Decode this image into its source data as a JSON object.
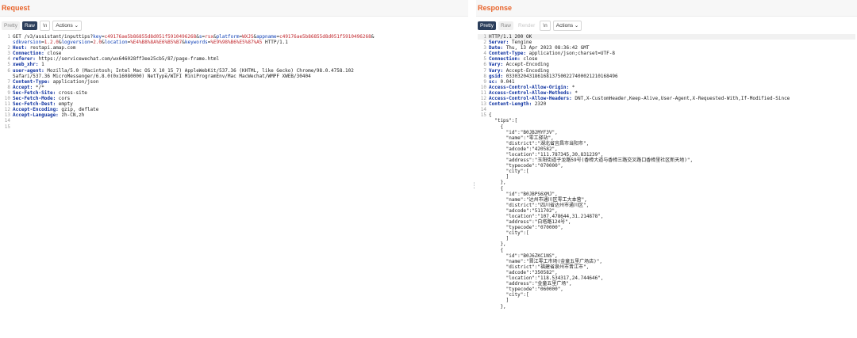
{
  "request": {
    "title": "Request",
    "tabs": [
      "Pretty",
      "Raw",
      "\\n",
      "Actions"
    ],
    "lines": [
      {
        "n": "1",
        "parts": [
          [
            "GET /v3/assistant/inputtips?",
            ""
          ],
          [
            "key",
            "pk"
          ],
          [
            "=",
            ""
          ],
          [
            "c49176ae5b86855d8d051f5910496268",
            "pv"
          ],
          [
            "&",
            ""
          ],
          [
            "s",
            "pk"
          ],
          [
            "=",
            ""
          ],
          [
            "rsx",
            "pv"
          ],
          [
            "&",
            ""
          ],
          [
            "platform",
            "pk"
          ],
          [
            "=",
            ""
          ],
          [
            "WXJS",
            "pv"
          ],
          [
            "&",
            ""
          ],
          [
            "appname",
            "pk"
          ],
          [
            "=",
            ""
          ],
          [
            "c49176ae5b86855d8d051f5910496268",
            "pv"
          ],
          [
            "&",
            ""
          ]
        ]
      },
      {
        "n": "",
        "parts": [
          [
            "sdkversion",
            "pk"
          ],
          [
            "=",
            ""
          ],
          [
            "1.2.0",
            "pv"
          ],
          [
            "&",
            ""
          ],
          [
            "logversion",
            "pk"
          ],
          [
            "=",
            ""
          ],
          [
            "2.0",
            "pv"
          ],
          [
            "&",
            ""
          ],
          [
            "location",
            "pk"
          ],
          [
            "=",
            ""
          ],
          [
            "%E4%B8%8A%E6%B5%B7",
            "pv"
          ],
          [
            "&",
            ""
          ],
          [
            "keywords",
            "pk"
          ],
          [
            "=",
            ""
          ],
          [
            "%E9%98%B6%E5%87%A5",
            "pv"
          ],
          [
            " HTTP/1.1",
            ""
          ]
        ]
      },
      {
        "n": "2",
        "parts": [
          [
            "Host: ",
            "k"
          ],
          [
            "restapi.amap.com",
            ""
          ]
        ]
      },
      {
        "n": "3",
        "parts": [
          [
            "Connection: ",
            "k"
          ],
          [
            "close",
            ""
          ]
        ]
      },
      {
        "n": "4",
        "parts": [
          [
            "referer: ",
            "k"
          ],
          [
            "https://servicewechat.com/wx646028ff3ee25cb5/87/page-frame.html",
            ""
          ]
        ]
      },
      {
        "n": "5",
        "parts": [
          [
            "xweb_xhr: ",
            "k"
          ],
          [
            "1",
            ""
          ]
        ]
      },
      {
        "n": "6",
        "parts": [
          [
            "user-agent: ",
            "k"
          ],
          [
            "Mozilla/5.0 (Macintosh; Intel Mac OS X 10_15_7) AppleWebKit/537.36 (KHTML, like Gecko) Chrome/98.0.4758.102",
            ""
          ]
        ]
      },
      {
        "n": "",
        "parts": [
          [
            "Safari/537.36 MicroMessenger/6.8.0(0x16080000) NetType/WIFI MiniProgramEnv/Mac MacWechat/WMPF XWEB/30404",
            ""
          ]
        ]
      },
      {
        "n": "7",
        "parts": [
          [
            "Content-Type: ",
            "k"
          ],
          [
            "application/json",
            ""
          ]
        ]
      },
      {
        "n": "8",
        "parts": [
          [
            "Accept: ",
            "k"
          ],
          [
            "*/*",
            ""
          ]
        ]
      },
      {
        "n": "9",
        "parts": [
          [
            "Sec-Fetch-Site: ",
            "k"
          ],
          [
            "cross-site",
            ""
          ]
        ]
      },
      {
        "n": "10",
        "parts": [
          [
            "Sec-Fetch-Mode: ",
            "k"
          ],
          [
            "cors",
            ""
          ]
        ]
      },
      {
        "n": "11",
        "parts": [
          [
            "Sec-Fetch-Dest: ",
            "k"
          ],
          [
            "empty",
            ""
          ]
        ]
      },
      {
        "n": "12",
        "parts": [
          [
            "Accept-Encoding: ",
            "k"
          ],
          [
            "gzip, deflate",
            ""
          ]
        ]
      },
      {
        "n": "13",
        "parts": [
          [
            "Accept-Language: ",
            "k"
          ],
          [
            "zh-CN,zh",
            ""
          ]
        ]
      },
      {
        "n": "14",
        "parts": []
      },
      {
        "n": "15",
        "parts": []
      }
    ]
  },
  "response": {
    "title": "Response",
    "tabs": [
      "Pretty",
      "Raw",
      "Render",
      "\\n",
      "Actions"
    ],
    "lines": [
      {
        "n": "1",
        "parts": [
          [
            "HTTP/1.1 200 OK",
            ""
          ]
        ]
      },
      {
        "n": "2",
        "parts": [
          [
            "Server: ",
            "k"
          ],
          [
            "Tengine",
            ""
          ]
        ]
      },
      {
        "n": "3",
        "parts": [
          [
            "Date: ",
            "k"
          ],
          [
            "Thu, 13 Apr 2023 08:36:42 GMT",
            ""
          ]
        ]
      },
      {
        "n": "4",
        "parts": [
          [
            "Content-Type: ",
            "k"
          ],
          [
            "application/json;charset=UTF-8",
            ""
          ]
        ]
      },
      {
        "n": "5",
        "parts": [
          [
            "Connection: ",
            "k"
          ],
          [
            "close",
            ""
          ]
        ]
      },
      {
        "n": "6",
        "parts": [
          [
            "Vary: ",
            "k"
          ],
          [
            "Accept-Encoding",
            ""
          ]
        ]
      },
      {
        "n": "7",
        "parts": [
          [
            "Vary: ",
            "k"
          ],
          [
            "Accept-Encoding",
            ""
          ]
        ]
      },
      {
        "n": "8",
        "parts": [
          [
            "gsid: ",
            "k"
          ],
          [
            "033032043186168137500227400021210168496",
            ""
          ]
        ]
      },
      {
        "n": "9",
        "parts": [
          [
            "sc: ",
            "k"
          ],
          [
            "0.041",
            ""
          ]
        ]
      },
      {
        "n": "10",
        "parts": [
          [
            "Access-Control-Allow-Origin: ",
            "k"
          ],
          [
            "*",
            ""
          ]
        ]
      },
      {
        "n": "11",
        "parts": [
          [
            "Access-Control-Allow-Methods: ",
            "k"
          ],
          [
            "*",
            ""
          ]
        ]
      },
      {
        "n": "12",
        "parts": [
          [
            "Access-Control-Allow-Headers: ",
            "k"
          ],
          [
            "DNT,X-CustomHeader,Keep-Alive,User-Agent,X-Requested-With,If-Modified-Since",
            ""
          ]
        ]
      },
      {
        "n": "13",
        "parts": [
          [
            "Content-Length: ",
            "k"
          ],
          [
            "2320",
            ""
          ]
        ]
      },
      {
        "n": "14",
        "parts": []
      },
      {
        "n": "15",
        "parts": [
          [
            "{",
            ""
          ]
        ]
      },
      {
        "n": "",
        "parts": [
          [
            "  \"tips\":[",
            ""
          ]
        ]
      },
      {
        "n": "",
        "parts": [
          [
            "    {",
            ""
          ]
        ]
      },
      {
        "n": "",
        "parts": [
          [
            "      \"id\":\"B0JB2MYF3V\",",
            ""
          ]
        ]
      },
      {
        "n": "",
        "parts": [
          [
            "      \"name\":\"零工驿站\",",
            ""
          ]
        ]
      },
      {
        "n": "",
        "parts": [
          [
            "      \"district\":\"湖北省宜昌市当阳市\",",
            ""
          ]
        ]
      },
      {
        "n": "",
        "parts": [
          [
            "      \"adcode\":\"420582\",",
            ""
          ]
        ]
      },
      {
        "n": "",
        "parts": [
          [
            "      \"location\":\"111.787345,30.831239\",",
            ""
          ]
        ]
      },
      {
        "n": "",
        "parts": [
          [
            "      \"address\":\"玉阳街道子龙路59号(香樟大道与香樟三路交叉路口香樟里社区新天地)\",",
            ""
          ]
        ]
      },
      {
        "n": "",
        "parts": [
          [
            "      \"typecode\":\"070000\",",
            ""
          ]
        ]
      },
      {
        "n": "",
        "parts": [
          [
            "      \"city\":[",
            ""
          ]
        ]
      },
      {
        "n": "",
        "parts": [
          [
            "      ]",
            ""
          ]
        ]
      },
      {
        "n": "",
        "parts": [
          [
            "    },",
            ""
          ]
        ]
      },
      {
        "n": "",
        "parts": [
          [
            "    {",
            ""
          ]
        ]
      },
      {
        "n": "",
        "parts": [
          [
            "      \"id\":\"B0JBPS6XMJ\",",
            ""
          ]
        ]
      },
      {
        "n": "",
        "parts": [
          [
            "      \"name\":\"达州市通川区零工大本营\",",
            ""
          ]
        ]
      },
      {
        "n": "",
        "parts": [
          [
            "      \"district\":\"四川省达州市通川区\",",
            ""
          ]
        ]
      },
      {
        "n": "",
        "parts": [
          [
            "      \"adcode\":\"511702\",",
            ""
          ]
        ]
      },
      {
        "n": "",
        "parts": [
          [
            "      \"location\":\"107.478644,31.214878\",",
            ""
          ]
        ]
      },
      {
        "n": "",
        "parts": [
          [
            "      \"address\":\"白塔路124号\",",
            ""
          ]
        ]
      },
      {
        "n": "",
        "parts": [
          [
            "      \"typecode\":\"070000\",",
            ""
          ]
        ]
      },
      {
        "n": "",
        "parts": [
          [
            "      \"city\":[",
            ""
          ]
        ]
      },
      {
        "n": "",
        "parts": [
          [
            "      ]",
            ""
          ]
        ]
      },
      {
        "n": "",
        "parts": [
          [
            "    },",
            ""
          ]
        ]
      },
      {
        "n": "",
        "parts": [
          [
            "    {",
            ""
          ]
        ]
      },
      {
        "n": "",
        "parts": [
          [
            "      \"id\":\"B0J6ZKC1NS\",",
            ""
          ]
        ]
      },
      {
        "n": "",
        "parts": [
          [
            "      \"name\":\"晋江零工市场(金童五里广场店)\",",
            ""
          ]
        ]
      },
      {
        "n": "",
        "parts": [
          [
            "      \"district\":\"福建省泉州市晋江市\",",
            ""
          ]
        ]
      },
      {
        "n": "",
        "parts": [
          [
            "      \"adcode\":\"350582\",",
            ""
          ]
        ]
      },
      {
        "n": "",
        "parts": [
          [
            "      \"location\":\"118.534317,24.744646\",",
            ""
          ]
        ]
      },
      {
        "n": "",
        "parts": [
          [
            "      \"address\":\"金童五里广场\",",
            ""
          ]
        ]
      },
      {
        "n": "",
        "parts": [
          [
            "      \"typecode\":\"060000\",",
            ""
          ]
        ]
      },
      {
        "n": "",
        "parts": [
          [
            "      \"city\":[",
            ""
          ]
        ]
      },
      {
        "n": "",
        "parts": [
          [
            "      ]",
            ""
          ]
        ]
      },
      {
        "n": "",
        "parts": [
          [
            "    },",
            ""
          ]
        ]
      }
    ]
  }
}
